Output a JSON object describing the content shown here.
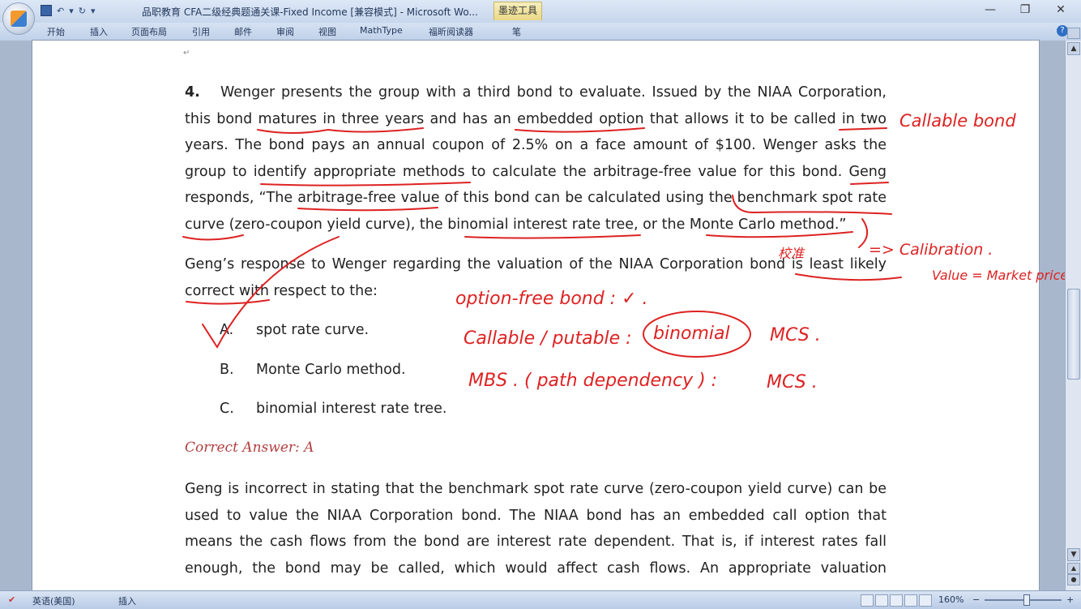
{
  "window": {
    "title": "品职教育 CFA二级经典题通关课-Fixed Income [兼容模式] - Microsoft Wo...",
    "contextual_tab": "墨迹工具",
    "controls": {
      "minimize": "—",
      "restore": "❐",
      "close": "✕"
    }
  },
  "quick_access": {
    "undo": "↶",
    "redo": "↻",
    "more": "▾"
  },
  "ribbon": {
    "tabs": [
      "开始",
      "插入",
      "页面布局",
      "引用",
      "邮件",
      "审阅",
      "视图",
      "MathType",
      "福昕阅读器",
      "笔"
    ],
    "help": "?"
  },
  "document": {
    "question_number": "4.",
    "question_lines": [
      "Wenger presents the group with a third bond to evaluate. Issued by the NIAA Corporation,",
      "this bond matures in three years and has an embedded option that allows it to be called in two",
      "years. The bond pays an annual coupon of 2.5% on a face amount of $100. Wenger asks the",
      "group to identify appropriate methods to calculate the arbitrage-free value for this bond. Geng",
      "responds, “The arbitrage-free value of this bond can be calculated using the benchmark spot rate",
      "curve (zero-coupon yield curve), the binomial interest rate tree, or the Monte Carlo method.”"
    ],
    "prompt_lines": [
      "Geng’s response to Wenger regarding the valuation of the NIAA Corporation bond is least likely",
      "correct with respect to the:"
    ],
    "options": [
      {
        "letter": "A.",
        "text": "spot rate curve."
      },
      {
        "letter": "B.",
        "text": "Monte Carlo method."
      },
      {
        "letter": "C.",
        "text": "binomial interest rate tree."
      }
    ],
    "correct_answer": "Correct Answer: A",
    "explanation_lines": [
      "Geng is incorrect in stating that the benchmark spot rate curve (zero-coupon yield curve) can be",
      "used to value the NIAA Corporation bond. The NIAA bond has an embedded call option that",
      "means the cash flows from the bond are interest rate dependent. That is, if interest rates fall",
      "enough, the bond may be called, which would affect cash flows. An appropriate valuation"
    ],
    "paragraph_mark": "↵"
  },
  "annotations": {
    "callable_bond": "Callable bond",
    "calibration": "=> Calibration .",
    "value_market_price": "Value = Market price",
    "cn_note": "校准",
    "option_free": "option-free bond : ✓ .",
    "callable_putable": "Callable / putable :",
    "binomial": "binomial",
    "mcs1": "MCS .",
    "mbs": "MBS . ( path dependency ) :",
    "mcs2": "MCS ."
  },
  "status_bar": {
    "language": "英语(美国)",
    "mode": "插入",
    "zoom": "160%",
    "zoom_level_percent": 160,
    "zoom_minus": "−",
    "zoom_plus": "+"
  }
}
